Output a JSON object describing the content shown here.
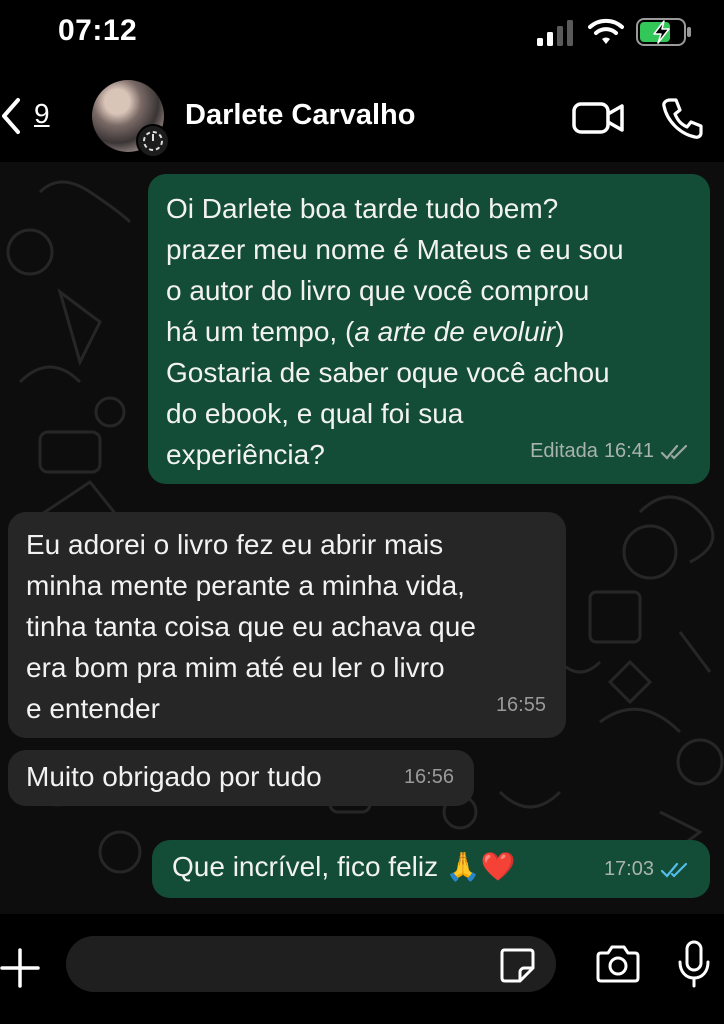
{
  "status_bar": {
    "time": "07:12"
  },
  "header": {
    "back_count": "9",
    "contact_name": "Darlete Carvalho"
  },
  "messages": [
    {
      "direction": "outgoing",
      "text_before": "Oi Darlete boa tarde tudo bem?\nprazer meu nome é Mateus e eu sou\no autor do livro que você comprou\nhá um tempo, (",
      "text_italic": "a arte de evoluir",
      "text_after": ")\nGostaria de saber oque você achou\ndo ebook, e qual foi sua\nexperiência?",
      "edited_label": "Editada",
      "time": "16:41",
      "status": "read"
    },
    {
      "direction": "incoming",
      "text": "Eu adorei o livro fez eu abrir mais\nminha mente perante a minha vida,\ntinha tanta coisa que eu achava que\nera bom pra mim até eu ler o livro\ne entender",
      "time": "16:55"
    },
    {
      "direction": "incoming",
      "text": "Muito obrigado por tudo",
      "time": "16:56"
    },
    {
      "direction": "outgoing",
      "text": "Que incrível, fico feliz 🙏❤️",
      "time": "17:03",
      "status": "read"
    }
  ],
  "composer": {
    "placeholder": ""
  },
  "icons": {
    "back": "chevron-left-icon",
    "video": "video-camera-icon",
    "phone": "phone-icon",
    "plus": "plus-icon",
    "sticker": "sticker-icon",
    "camera": "camera-icon",
    "mic": "microphone-icon",
    "read_ticks": "double-check-icon"
  },
  "colors": {
    "outgoing_bubble": "#144d37",
    "incoming_bubble": "#262626",
    "read_tick": "#53bdeb",
    "background": "#0b0b0b"
  }
}
